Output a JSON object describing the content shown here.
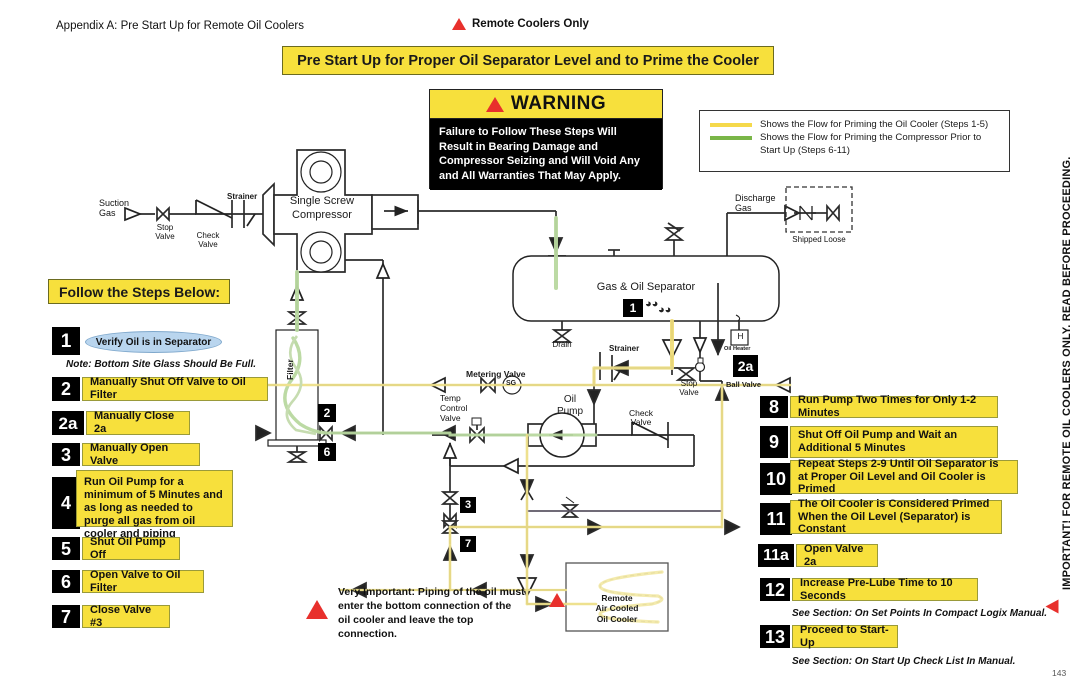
{
  "header": {
    "appendix": "Appendix A: Pre Start Up for Remote Oil Coolers",
    "remote_only": "Remote Coolers Only",
    "title_banner": "Pre Start Up for Proper Oil Separator Level and to Prime the Cooler",
    "page_number": "143",
    "side_note": "IMPORTANT! FOR REMOTE OIL COOLERS ONLY. READ BEFORE PROCEEDING."
  },
  "warning": {
    "heading": "WARNING",
    "body": "Failure to Follow These Steps Will Result in Bearing Damage and Compressor Seizing and Will Void Any and All Warranties That May Apply."
  },
  "legend": {
    "items": [
      {
        "color": "#f5d94b",
        "text": "Shows the Flow for Priming the Oil Cooler (Steps 1-5)"
      },
      {
        "color": "#7ab648",
        "text": "Shows the Flow for Priming the Compressor Prior to Start Up (Steps 6-11)"
      }
    ]
  },
  "steps_heading": "Follow the Steps Below:",
  "steps_left": [
    {
      "num": "1",
      "text": "Verify Oil is in Separator",
      "shape": "ellipse"
    },
    {
      "num": "2",
      "text": "Manually Shut Off Valve to Oil Filter"
    },
    {
      "num": "2a",
      "text": "Manually Close 2a"
    },
    {
      "num": "3",
      "text": "Manually Open Valve"
    },
    {
      "num": "4",
      "text": "Run Oil Pump for a minimum of 5 Minutes and as long as needed to purge all gas from oil cooler and piping"
    },
    {
      "num": "5",
      "text": "Shut Oil Pump Off"
    },
    {
      "num": "6",
      "text": "Open Valve to Oil Filter"
    },
    {
      "num": "7",
      "text": "Close Valve #3"
    }
  ],
  "step1_note": "Note: Bottom Site Glass Should Be Full.",
  "steps_right": [
    {
      "num": "8",
      "text": "Run Pump Two Times for Only 1-2 Minutes"
    },
    {
      "num": "9",
      "text": "Shut Off Oil Pump and Wait an Additional 5 Minutes"
    },
    {
      "num": "10",
      "text": "Repeat Steps 2-9 Until Oil Separator is at Proper Oil Level and Oil Cooler is Primed"
    },
    {
      "num": "11",
      "text": "The Oil Cooler is Considered Primed When the Oil Level (Separator) is Constant"
    },
    {
      "num": "11a",
      "text": "Open Valve 2a"
    },
    {
      "num": "12",
      "text": "Increase Pre-Lube Time to 10 Seconds"
    },
    {
      "num": "13",
      "text": "Proceed to Start-Up"
    }
  ],
  "notes_right": {
    "after_12": "See Section: On Set Points In Compact Logix Manual.",
    "after_13": "See Section: On Start Up Check List In Manual."
  },
  "very_important": "Very Important: Piping of the oil must enter the bottom connection of the oil cooler and leave the top connection.",
  "diagram": {
    "suction_gas": "Suction\nGas",
    "stop_valve_1": "Stop\nValve",
    "check_valve_1": "Check\nValve",
    "strainer_1": "Strainer",
    "compressor": "Single Screw\nCompressor",
    "discharge_gas": "Discharge\nGas",
    "shipped_loose": "Shipped Loose",
    "separator": "Gas & Oil Separator",
    "separator_tag": "1",
    "drain": "Drain",
    "strainer_2": "Strainer",
    "stop_valve_2": "Stop\nValve",
    "oil_heater_box": "H",
    "oil_heater_label": "Oil Heater",
    "ball_valve_tag": "2a",
    "ball_valve_label": "Ball Valve",
    "metering_valve": "Metering Valve",
    "sight_glass": "SG",
    "temp_control_valve": "Temp\nControl\nValve",
    "oil_pump": "Oil\nPump",
    "check_valve_2": "Check\nValve",
    "filter": "Filter",
    "valve_tag_2": "2",
    "valve_tag_6": "6",
    "valve_tag_3": "3",
    "valve_tag_7": "7",
    "cooler_label": "Remote\nAir Cooled\nOil Cooler"
  }
}
